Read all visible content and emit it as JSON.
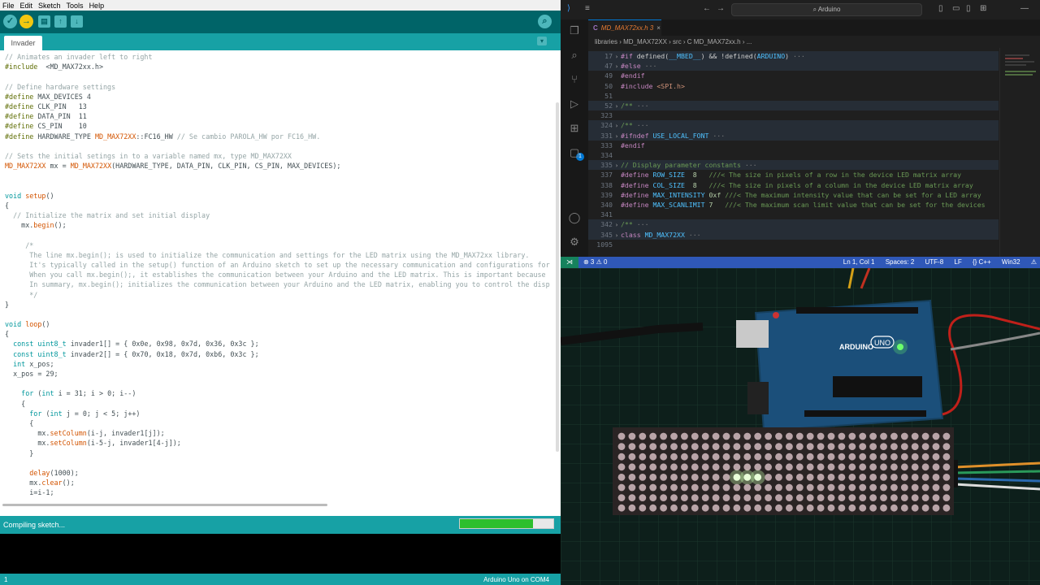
{
  "arduino": {
    "menu": [
      "File",
      "Edit",
      "Sketch",
      "Tools",
      "Help"
    ],
    "toolbar": {
      "verify": "✓",
      "upload": "→",
      "new": "▤",
      "open": "↑",
      "save": "↓",
      "serial_monitor": "⌕"
    },
    "tab_name": "Invader",
    "tab_menu": "▾",
    "code_lines": [
      [
        [
          "c",
          "// Animates an invader left to right"
        ]
      ],
      [
        [
          "p",
          "#include"
        ],
        [
          "",
          "  <MD_MAX72xx.h>"
        ]
      ],
      [],
      [
        [
          "c",
          "// Define hardware settings"
        ]
      ],
      [
        [
          "p",
          "#define"
        ],
        [
          "",
          " MAX_DEVICES 4"
        ]
      ],
      [
        [
          "p",
          "#define"
        ],
        [
          "",
          " CLK_PIN   13"
        ]
      ],
      [
        [
          "p",
          "#define"
        ],
        [
          "",
          " DATA_PIN  11"
        ]
      ],
      [
        [
          "p",
          "#define"
        ],
        [
          "",
          " CS_PIN    10"
        ]
      ],
      [
        [
          "p",
          "#define"
        ],
        [
          "",
          " HARDWARE_TYPE "
        ],
        [
          "f",
          "MD_MAX72XX"
        ],
        [
          "",
          "::FC16_HW "
        ],
        [
          "c",
          "// Se cambio PAROLA_HW por FC16_HW."
        ]
      ],
      [],
      [
        [
          "c",
          "// Sets the initial setings in to a variable named mx, type MD_MAX72XX"
        ]
      ],
      [
        [
          "f",
          "MD_MAX72XX"
        ],
        [
          "",
          " mx = "
        ],
        [
          "f",
          "MD_MAX72XX"
        ],
        [
          "",
          "(HARDWARE_TYPE, DATA_PIN, CLK_PIN, CS_PIN, MAX_DEVICES);"
        ]
      ],
      [],
      [],
      [
        [
          "k",
          "void"
        ],
        [
          "",
          " "
        ],
        [
          "f",
          "setup"
        ],
        [
          "",
          "()"
        ]
      ],
      [
        [
          "",
          "{"
        ]
      ],
      [
        [
          "",
          "  "
        ],
        [
          "c",
          "// Initialize the matrix and set initial display"
        ]
      ],
      [
        [
          "",
          "    mx."
        ],
        [
          "f",
          "begin"
        ],
        [
          "",
          "();"
        ]
      ],
      [],
      [
        [
          "c",
          "     /*"
        ]
      ],
      [
        [
          "c",
          "      The line mx.begin(); is used to initialize the communication and settings for the LED matrix using the MD_MAX72xx library."
        ]
      ],
      [
        [
          "c",
          "      It's typically called in the setup() function of an Arduino sketch to set up the necessary communication and configurations for"
        ]
      ],
      [
        [
          "c",
          "      When you call mx.begin();, it establishes the communication between your Arduino and the LED matrix. This is important because"
        ]
      ],
      [
        [
          "c",
          "      In summary, mx.begin(); initializes the communication between your Arduino and the LED matrix, enabling you to control the disp"
        ]
      ],
      [
        [
          "c",
          "      */"
        ]
      ],
      [
        [
          "",
          "}"
        ]
      ],
      [],
      [
        [
          "k",
          "void"
        ],
        [
          "",
          " "
        ],
        [
          "f",
          "loop"
        ],
        [
          "",
          "()"
        ]
      ],
      [
        [
          "",
          "{"
        ]
      ],
      [
        [
          "",
          "  "
        ],
        [
          "k",
          "const"
        ],
        [
          "",
          " "
        ],
        [
          "t",
          "uint8_t"
        ],
        [
          "",
          " invader1[] = { 0x0e, 0x98, 0x7d, 0x36, 0x3c };"
        ]
      ],
      [
        [
          "",
          "  "
        ],
        [
          "k",
          "const"
        ],
        [
          "",
          " "
        ],
        [
          "t",
          "uint8_t"
        ],
        [
          "",
          " invader2[] = { 0x70, 0x18, 0x7d, 0xb6, 0x3c };"
        ]
      ],
      [
        [
          "",
          "  "
        ],
        [
          "k",
          "int"
        ],
        [
          "",
          " x_pos;"
        ]
      ],
      [
        [
          "",
          "  x_pos = 29;"
        ]
      ],
      [],
      [
        [
          "",
          "    "
        ],
        [
          "k",
          "for"
        ],
        [
          "",
          " ("
        ],
        [
          "k",
          "int"
        ],
        [
          "",
          " i = 31; i > 0; i--)"
        ]
      ],
      [
        [
          "",
          "    {"
        ]
      ],
      [
        [
          "",
          "      "
        ],
        [
          "k",
          "for"
        ],
        [
          "",
          " ("
        ],
        [
          "k",
          "int"
        ],
        [
          "",
          " j = 0; j < 5; j++)"
        ]
      ],
      [
        [
          "",
          "      {"
        ]
      ],
      [
        [
          "",
          "        mx."
        ],
        [
          "f",
          "setColumn"
        ],
        [
          "",
          "(i-j, invader1[j]);"
        ]
      ],
      [
        [
          "",
          "        mx."
        ],
        [
          "f",
          "setColumn"
        ],
        [
          "",
          "(i-5-j, invader1[4-j]);"
        ]
      ],
      [
        [
          "",
          "      }"
        ]
      ],
      [],
      [
        [
          "",
          "      "
        ],
        [
          "f",
          "delay"
        ],
        [
          "",
          "(1000);"
        ]
      ],
      [
        [
          "",
          "      mx."
        ],
        [
          "f",
          "clear"
        ],
        [
          "",
          "();"
        ]
      ],
      [
        [
          "",
          "      i=i-1;"
        ]
      ]
    ],
    "status": "Compiling sketch...",
    "progress": 0.78,
    "line_number": "1",
    "board": "Arduino Uno on COM4"
  },
  "vscode": {
    "search_text": "⌕ Arduino",
    "tab_icon": "C",
    "tab_title": "MD_MAX72xx.h 3",
    "tab_close": "×",
    "breadcrumb": "libraries › MD_MAX72XX › src › C  MD_MAX72xx.h › ...",
    "lines": [
      {
        "n": "17",
        "fold": "›",
        "hl": true,
        "parts": [
          [
            "pp",
            "#if "
          ],
          [
            "",
            "defined"
          ],
          [
            "",
            "("
          ],
          [
            "vid",
            "__MBED__"
          ],
          [
            "",
            ") && !"
          ],
          [
            "",
            "defined"
          ],
          [
            "",
            "("
          ],
          [
            "vid",
            "ARDUINO"
          ],
          [
            "",
            ")"
          ],
          [
            "vdim",
            " ···"
          ]
        ]
      },
      {
        "n": "47",
        "fold": "›",
        "hl": true,
        "parts": [
          [
            "pp",
            "#else"
          ],
          [
            "vdim",
            " ···"
          ]
        ]
      },
      {
        "n": "49",
        "fold": "",
        "hl": false,
        "parts": [
          [
            "pp",
            "#endif"
          ]
        ]
      },
      {
        "n": "50",
        "fold": "",
        "hl": false,
        "parts": [
          [
            "pp",
            "#include "
          ],
          [
            "vstr",
            "<SPI.h>"
          ]
        ]
      },
      {
        "n": "51",
        "fold": "",
        "hl": false,
        "parts": []
      },
      {
        "n": "52",
        "fold": "›",
        "hl": true,
        "parts": [
          [
            "vcm",
            "/**"
          ],
          [
            "vdim",
            " ···"
          ]
        ]
      },
      {
        "n": "323",
        "fold": "",
        "hl": false,
        "parts": []
      },
      {
        "n": "324",
        "fold": "›",
        "hl": true,
        "parts": [
          [
            "vcm",
            "/**"
          ],
          [
            "vdim",
            " ···"
          ]
        ]
      },
      {
        "n": "331",
        "fold": "›",
        "hl": true,
        "parts": [
          [
            "pp",
            "#ifndef "
          ],
          [
            "vid",
            "USE_LOCAL_FONT"
          ],
          [
            "vdim",
            " ···"
          ]
        ]
      },
      {
        "n": "333",
        "fold": "",
        "hl": false,
        "parts": [
          [
            "pp",
            "#endif"
          ]
        ]
      },
      {
        "n": "334",
        "fold": "",
        "hl": false,
        "parts": []
      },
      {
        "n": "335",
        "fold": "›",
        "hl": true,
        "parts": [
          [
            "vcm",
            "// Display parameter constants"
          ],
          [
            "vdim",
            " ···"
          ]
        ]
      },
      {
        "n": "337",
        "fold": "",
        "hl": false,
        "parts": [
          [
            "pp",
            "#define "
          ],
          [
            "vid",
            "ROW_SIZE"
          ],
          [
            "",
            "  "
          ],
          [
            "vnum",
            "8"
          ],
          [
            "vcm",
            "   ///< The size in pixels of a row in the device LED matrix array"
          ]
        ]
      },
      {
        "n": "338",
        "fold": "",
        "hl": false,
        "parts": [
          [
            "pp",
            "#define "
          ],
          [
            "vid",
            "COL_SIZE"
          ],
          [
            "",
            "  "
          ],
          [
            "vnum",
            "8"
          ],
          [
            "vcm",
            "   ///< The size in pixels of a column in the device LED matrix array"
          ]
        ]
      },
      {
        "n": "339",
        "fold": "",
        "hl": false,
        "parts": [
          [
            "pp",
            "#define "
          ],
          [
            "vid",
            "MAX_INTENSITY"
          ],
          [
            "",
            " "
          ],
          [
            "vnum",
            "0xf"
          ],
          [
            "vcm",
            " ///< The maximum intensity value that can be set for a LED array"
          ]
        ]
      },
      {
        "n": "340",
        "fold": "",
        "hl": false,
        "parts": [
          [
            "pp",
            "#define "
          ],
          [
            "vid",
            "MAX_SCANLIMIT"
          ],
          [
            "",
            " "
          ],
          [
            "vnum",
            "7"
          ],
          [
            "vcm",
            "   ///< The maximum scan limit value that can be set for the devices"
          ]
        ]
      },
      {
        "n": "341",
        "fold": "",
        "hl": false,
        "parts": []
      },
      {
        "n": "342",
        "fold": "›",
        "hl": true,
        "parts": [
          [
            "vcm",
            "/**"
          ],
          [
            "vdim",
            " ···"
          ]
        ]
      },
      {
        "n": "345",
        "fold": "›",
        "hl": true,
        "parts": [
          [
            "pp",
            "class "
          ],
          [
            "vid",
            "MD_MAX72XX"
          ],
          [
            "vdim",
            " ···"
          ]
        ]
      },
      {
        "n": "1095",
        "fold": "",
        "hl": false,
        "parts": []
      }
    ],
    "status": {
      "remote": "⋊",
      "problems": "⊗ 3 ⚠ 0",
      "position": "Ln 1, Col 1",
      "spaces": "Spaces: 2",
      "encoding": "UTF-8",
      "eol": "LF",
      "language": "{} C++",
      "platform": "Win32"
    },
    "activity_badge": "1"
  },
  "camera": {
    "board_label": "ARDUINO",
    "board_model": "UNO",
    "lit_leds": [
      [
        11,
        4
      ],
      [
        12,
        4
      ],
      [
        13,
        4
      ]
    ],
    "colors": {
      "led_off": "#b9a4a8",
      "led_on": "#e8ffd8",
      "mat": "#15302a"
    }
  }
}
